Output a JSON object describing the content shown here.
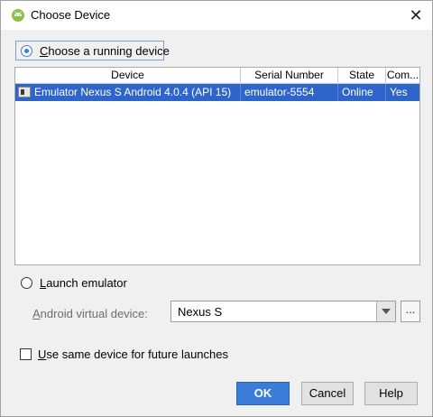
{
  "window": {
    "title": "Choose Device",
    "close_glyph": "✕",
    "app_icon": "android-icon"
  },
  "running": {
    "label_prefix": "C",
    "label_rest": "hoose a running device",
    "selected": true
  },
  "table": {
    "columns": [
      "Device",
      "Serial Number",
      "State",
      "Com..."
    ],
    "rows": [
      {
        "device": "Emulator Nexus S Android 4.0.4 (API 15)",
        "serial": "emulator-5554",
        "state": "Online",
        "compatible": "Yes",
        "icon": "device-icon"
      }
    ],
    "selection_color": "#2f65ca"
  },
  "launch": {
    "label_prefix": "L",
    "label_rest": "aunch emulator",
    "selected": false,
    "avd_label_prefix": "A",
    "avd_label_rest": "ndroid virtual device:",
    "avd_value": "Nexus S",
    "ellipsis": "..."
  },
  "reuse": {
    "label_prefix": "U",
    "label_rest": "se same device for future launches",
    "checked": false
  },
  "buttons": {
    "ok": "OK",
    "cancel": "Cancel",
    "help": "Help"
  },
  "colors": {
    "accent": "#3b7cd8"
  }
}
